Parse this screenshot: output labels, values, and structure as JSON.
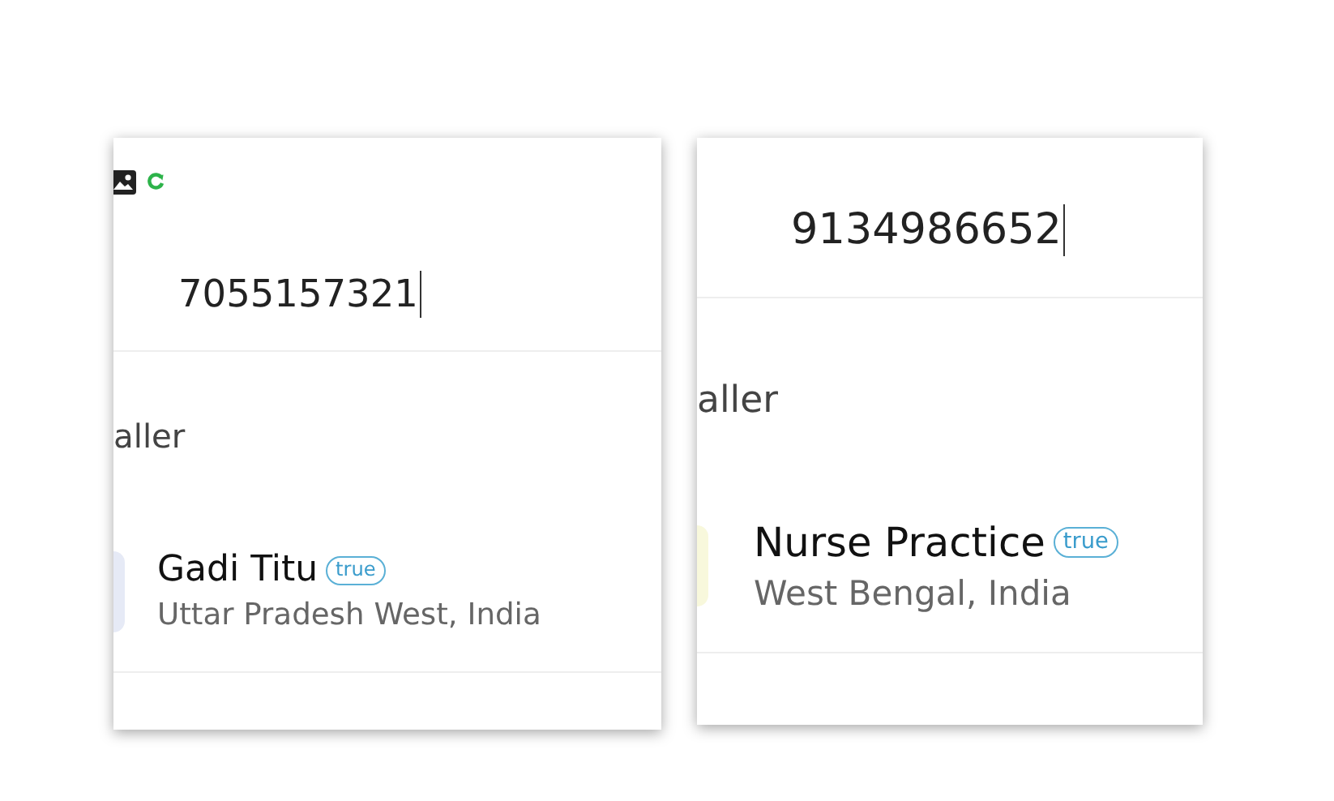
{
  "panels": [
    {
      "status_icons": true,
      "number": "7055157321",
      "section_label": "aller",
      "contact": {
        "name": "Gadi Titu",
        "badge": "true",
        "location": "Uttar Pradesh West, India",
        "color": "#e6eaf6"
      }
    },
    {
      "status_icons": false,
      "number": "9134986652",
      "section_label": "aller",
      "contact": {
        "name": "Nurse Practice",
        "badge": "true",
        "location": "West Bengal, India",
        "color": "#f8f8dc"
      }
    }
  ]
}
